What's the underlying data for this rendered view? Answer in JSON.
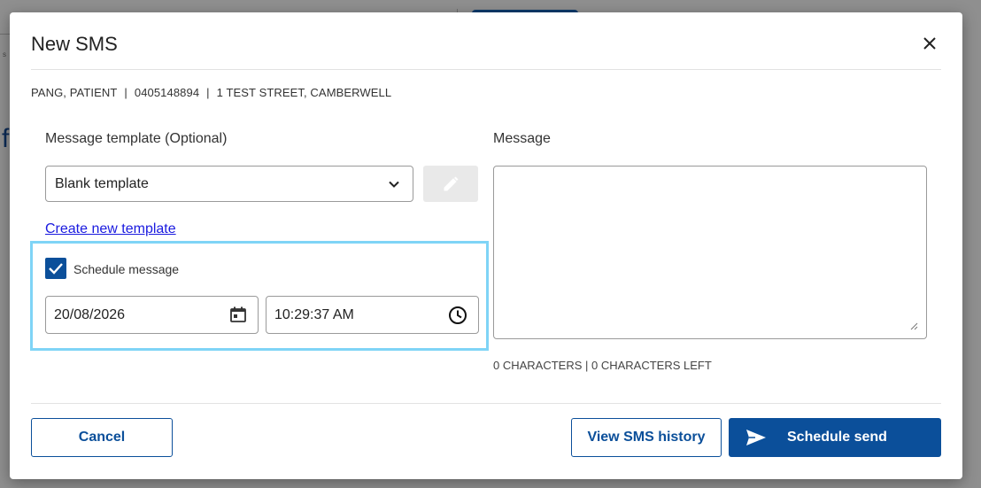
{
  "dialog": {
    "title": "New SMS",
    "close_icon": "close-icon"
  },
  "patient": {
    "name": "PANG, PATIENT",
    "separator": "|",
    "phone": "0405148894",
    "address": "1 TEST STREET, CAMBERWELL"
  },
  "template": {
    "label": "Message template (Optional)",
    "selected": "Blank template",
    "dropdown_icon": "chevron-down-icon",
    "edit_icon": "pencil-icon",
    "create_link": "Create new template"
  },
  "schedule": {
    "checkbox_label": "Schedule message",
    "checked": true,
    "date": "20/08/2026",
    "date_icon": "calendar-icon",
    "time": "10:29:37 AM",
    "time_icon": "clock-icon",
    "highlight_color": "#7fd4f6"
  },
  "message": {
    "label": "Message",
    "value": "",
    "counter": "0 CHARACTERS | 0 CHARACTERS LEFT"
  },
  "footer": {
    "cancel": "Cancel",
    "history": "View SMS history",
    "send": "Schedule send",
    "send_icon": "send-icon"
  },
  "colors": {
    "primary": "#0b4f9a",
    "link": "#1a1adf"
  }
}
